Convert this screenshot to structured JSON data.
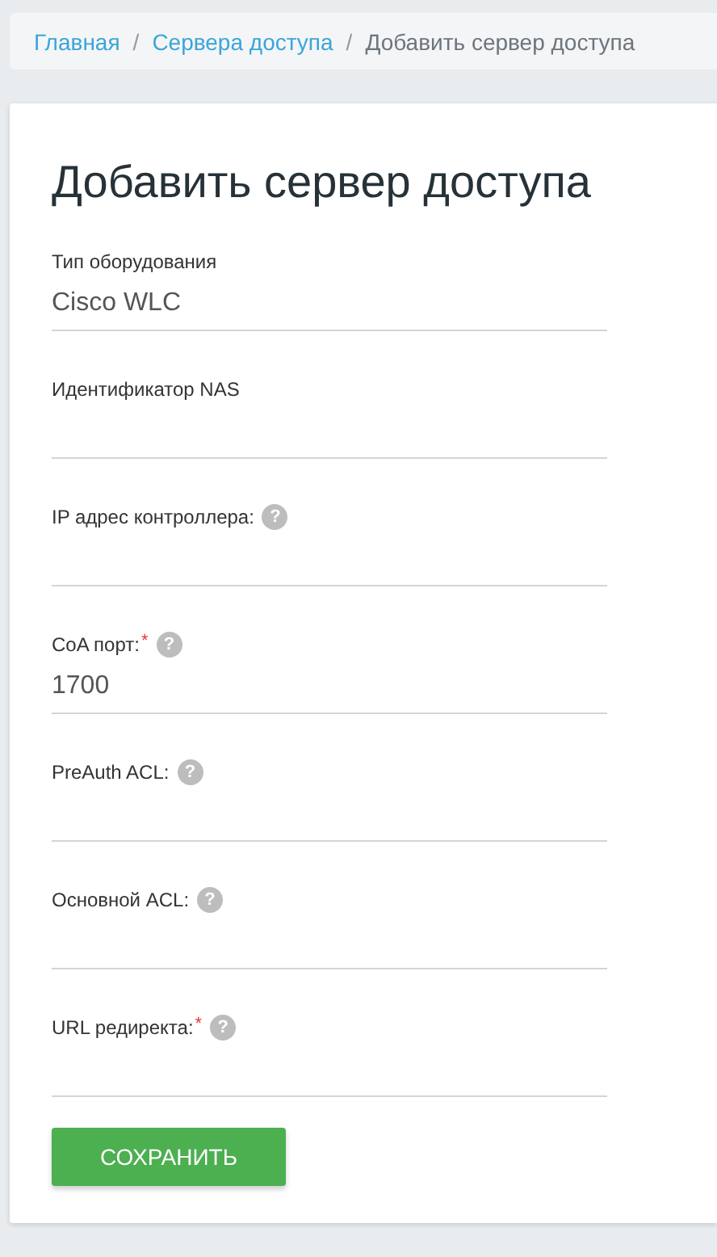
{
  "breadcrumb": [
    {
      "label": "Главная",
      "kind": "link"
    },
    {
      "label": "Сервера доступа",
      "kind": "link"
    },
    {
      "label": "Добавить сервер доступа",
      "kind": "current"
    }
  ],
  "separator": "/",
  "title": "Добавить сервер доступа",
  "fields": [
    {
      "label": "Тип оборудования",
      "value": "Cisco WLC"
    },
    {
      "label": "Идентификатор NAS"
    },
    {
      "label": "IP адрес контроллера:",
      "help": "?"
    },
    {
      "label": "CoA порт:",
      "required_mark": "*",
      "help": "?",
      "value": "1700"
    },
    {
      "label": "PreAuth ACL:",
      "help": "?"
    },
    {
      "label": "Основной ACL:",
      "help": "?"
    },
    {
      "label": "URL редиректа:",
      "required_mark": "*",
      "help": "?"
    }
  ],
  "save_button": "СОХРАНИТЬ"
}
